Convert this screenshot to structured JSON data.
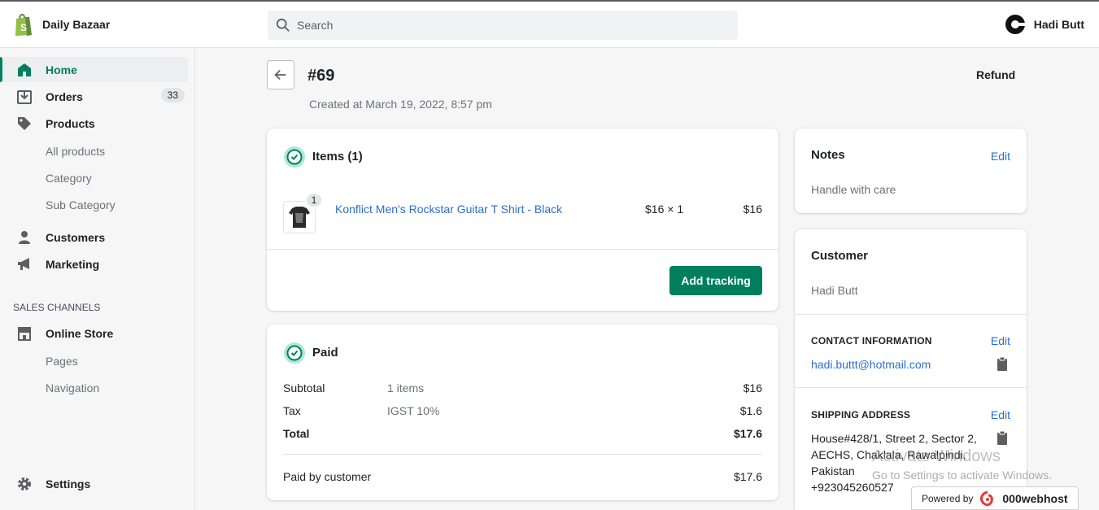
{
  "brand": {
    "name": "Daily Bazaar",
    "logo": "shopify-bag-icon",
    "accent": "#008060"
  },
  "search": {
    "placeholder": "Search"
  },
  "user": {
    "name": "Hadi Butt"
  },
  "sidebar": {
    "items": [
      {
        "label": "Home",
        "icon": "home-icon",
        "active": true
      },
      {
        "label": "Orders",
        "icon": "orders-icon",
        "badge": "33"
      },
      {
        "label": "Products",
        "icon": "tag-icon"
      },
      {
        "label": "All products"
      },
      {
        "label": "Category"
      },
      {
        "label": "Sub Category"
      },
      {
        "label": "Customers",
        "icon": "person-icon"
      },
      {
        "label": "Marketing",
        "icon": "megaphone-icon"
      }
    ],
    "sales_channels_label": "SALES CHANNELS",
    "channels": [
      {
        "label": "Online Store",
        "icon": "store-icon"
      },
      {
        "label": "Pages"
      },
      {
        "label": "Navigation"
      }
    ],
    "settings_label": "Settings"
  },
  "order": {
    "title": "#69",
    "created": "Created at March 19, 2022, 8:57 pm",
    "refund_label": "Refund"
  },
  "items_card": {
    "title": "Items (1)",
    "line": {
      "qty_badge": "1",
      "name": "Konflict Men's Rockstar Guitar T Shirt - Black",
      "price_qty": "$16 × 1",
      "total": "$16"
    },
    "action": "Add tracking"
  },
  "paid_card": {
    "title": "Paid",
    "rows": [
      {
        "label": "Subtotal",
        "detail": "1 items",
        "amount": "$16"
      },
      {
        "label": "Tax",
        "detail": "IGST 10%",
        "amount": "$1.6"
      },
      {
        "label": "Total",
        "detail": "",
        "amount": "$17.6"
      }
    ],
    "paid_by": {
      "label": "Paid by customer",
      "amount": "$17.6"
    }
  },
  "notes_card": {
    "title": "Notes",
    "edit": "Edit",
    "text": "Handle with care"
  },
  "customer_card": {
    "title": "Customer",
    "name": "Hadi Butt",
    "contact_label": "CONTACT INFORMATION",
    "contact_edit": "Edit",
    "email": "hadi.buttt@hotmail.com",
    "shipping_label": "SHIPPING ADDRESS",
    "shipping_edit": "Edit",
    "address_line1": "House#428/1, Street 2, Sector 2,",
    "address_line2": "AECHS, Chaklala, Rawalpindi,",
    "address_line3": "Pakistan",
    "phone": "+923045260527"
  },
  "overlay": {
    "watermark_title": "Activate Windows",
    "watermark_sub": "Go to Settings to activate Windows.",
    "powered_by": "Powered by",
    "powered_brand": "000webhost"
  }
}
